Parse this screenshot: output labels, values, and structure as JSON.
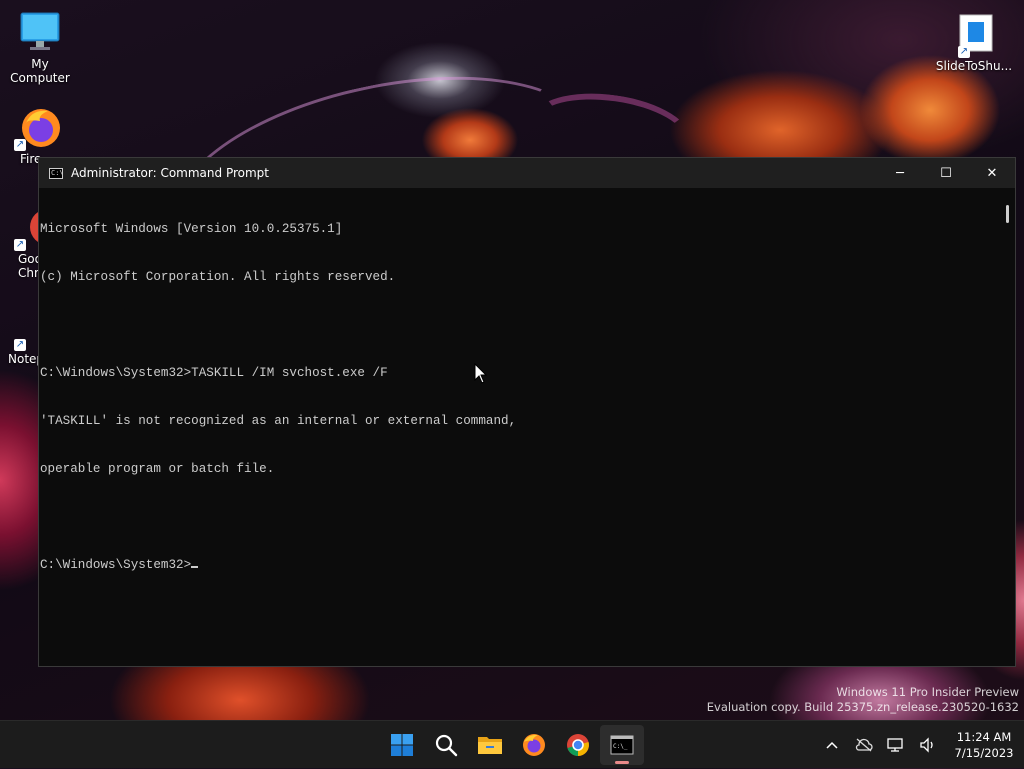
{
  "desktop": {
    "icons": [
      {
        "label": "My Computer",
        "icon": "monitor-icon"
      },
      {
        "label": "Fire",
        "icon": "firefox-icon"
      },
      {
        "label": "Goo\nChro",
        "icon": "chrome-icon"
      },
      {
        "label": "Notep",
        "icon": "notepad-icon"
      },
      {
        "label": "SlideToShu...",
        "icon": "document-icon"
      }
    ]
  },
  "window": {
    "title": "Administrator: Command Prompt",
    "icon": "cmd-icon",
    "controls": {
      "minimize": "─",
      "maximize": "☐",
      "close": "✕"
    },
    "console_lines": [
      "Microsoft Windows [Version 10.0.25375.1]",
      "(c) Microsoft Corporation. All rights reserved.",
      "",
      "C:\\Windows\\System32>TASKILL /IM svchost.exe /F",
      "'TASKILL' is not recognized as an internal or external command,",
      "operable program or batch file.",
      "",
      "C:\\Windows\\System32>"
    ]
  },
  "watermark": {
    "line1": "Windows 11 Pro Insider Preview",
    "line2": "Evaluation copy. Build 25375.zn_release.230520-1632"
  },
  "taskbar": {
    "apps": [
      {
        "name": "start-button",
        "icon": "windows-logo-icon"
      },
      {
        "name": "search-button",
        "icon": "search-icon"
      },
      {
        "name": "file-explorer-button",
        "icon": "folder-icon"
      },
      {
        "name": "firefox-button",
        "icon": "firefox-icon"
      },
      {
        "name": "chrome-button",
        "icon": "chrome-icon"
      },
      {
        "name": "terminal-button",
        "icon": "cmd-icon",
        "active": true
      }
    ],
    "tray": {
      "time": "11:24 AM",
      "date": "7/15/2023"
    }
  },
  "colors": {
    "console_bg": "#0c0c0c",
    "console_text": "#cccccc",
    "titlebar_bg": "#1f1f1f",
    "taskbar_bg": "#1c1c1c",
    "accent_indicator": "#e98a8a"
  }
}
